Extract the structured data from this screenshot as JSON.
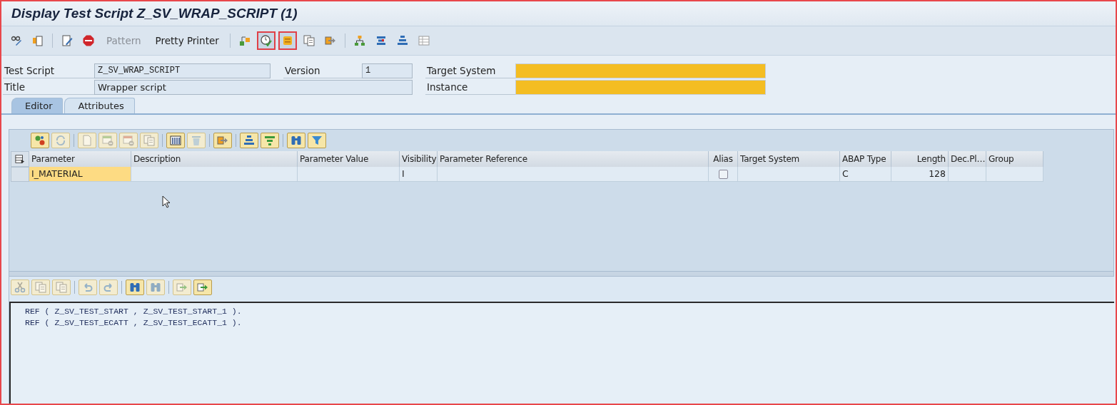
{
  "window": {
    "title": "Display Test Script Z_SV_WRAP_SCRIPT (1)"
  },
  "toolbar": [
    {
      "kind": "icon",
      "highlighted": false
    },
    {
      "kind": "icon",
      "highlighted": false
    },
    {
      "kind": "separator"
    },
    {
      "kind": "icon",
      "highlighted": false
    },
    {
      "kind": "icon",
      "highlighted": false
    },
    {
      "kind": "text",
      "label": "Pattern",
      "disabled": true
    },
    {
      "kind": "text",
      "label": "Pretty Printer",
      "disabled": false
    },
    {
      "kind": "separator"
    },
    {
      "kind": "icon",
      "highlighted": false
    },
    {
      "kind": "icon",
      "highlighted": true
    },
    {
      "kind": "icon",
      "highlighted": true
    },
    {
      "kind": "icon",
      "highlighted": false
    },
    {
      "kind": "icon",
      "highlighted": false
    },
    {
      "kind": "separator"
    },
    {
      "kind": "icon",
      "highlighted": false
    },
    {
      "kind": "icon",
      "highlighted": false
    },
    {
      "kind": "icon",
      "highlighted": false
    },
    {
      "kind": "icon",
      "highlighted": false
    }
  ],
  "header_fields": [
    {
      "label": "Test Script",
      "value": "Z_SV_WRAP_SCRIPT",
      "kind": "mono",
      "redacted": false
    },
    {
      "label": "Version",
      "value": "1",
      "kind": "mono",
      "redacted": false
    },
    {
      "label": "Target System",
      "kind": "text",
      "redacted": true
    },
    {
      "label": "Title",
      "value": "Wrapper script",
      "kind": "text",
      "redacted": false
    },
    {
      "label": "Instance",
      "kind": "text",
      "redacted": true
    }
  ],
  "tabs": [
    {
      "label": "Editor",
      "selected": true
    },
    {
      "label": "Attributes",
      "selected": false
    }
  ],
  "grid_toolbar": [
    {
      "kind": "button",
      "disabled": false
    },
    {
      "kind": "button",
      "disabled": true
    },
    {
      "kind": "separator"
    },
    {
      "kind": "button",
      "disabled": true
    },
    {
      "kind": "button",
      "disabled": true
    },
    {
      "kind": "button",
      "disabled": true
    },
    {
      "kind": "button",
      "disabled": true
    },
    {
      "kind": "separator"
    },
    {
      "kind": "button",
      "disabled": false
    },
    {
      "kind": "button",
      "disabled": true
    },
    {
      "kind": "separator"
    },
    {
      "kind": "button",
      "disabled": false
    },
    {
      "kind": "separator"
    },
    {
      "kind": "button",
      "disabled": false
    },
    {
      "kind": "button",
      "disabled": false
    },
    {
      "kind": "separator"
    },
    {
      "kind": "button",
      "disabled": false
    },
    {
      "kind": "button",
      "disabled": false
    }
  ],
  "table": {
    "columns": [
      {
        "label": "Parameter",
        "kind": "key"
      },
      {
        "label": "Description",
        "kind": "text"
      },
      {
        "label": "Parameter Value",
        "kind": "text"
      },
      {
        "label": "Visibility",
        "kind": "text"
      },
      {
        "label": "Parameter Reference",
        "kind": "text"
      },
      {
        "label": "Alias",
        "kind": "checkbox"
      },
      {
        "label": "Target System",
        "kind": "text"
      },
      {
        "label": "ABAP Type",
        "kind": "text"
      },
      {
        "label": "Length",
        "kind": "number"
      },
      {
        "label": "Dec.Pl…",
        "kind": "number"
      },
      {
        "label": "Group",
        "kind": "text"
      }
    ],
    "rows": [
      {
        "cells": [
          "I_MATERIAL",
          "",
          "",
          "I",
          "",
          false,
          "",
          "C",
          "128",
          "",
          ""
        ]
      }
    ]
  },
  "editor_toolbar": [
    {
      "kind": "button",
      "disabled": true
    },
    {
      "kind": "button",
      "disabled": true
    },
    {
      "kind": "button",
      "disabled": true
    },
    {
      "kind": "separator"
    },
    {
      "kind": "button",
      "disabled": true
    },
    {
      "kind": "button",
      "disabled": true
    },
    {
      "kind": "separator"
    },
    {
      "kind": "button",
      "disabled": false
    },
    {
      "kind": "button",
      "disabled": true
    },
    {
      "kind": "separator"
    },
    {
      "kind": "button",
      "disabled": true
    },
    {
      "kind": "button",
      "disabled": false
    }
  ],
  "code_lines": [
    "REF ( Z_SV_TEST_START , Z_SV_TEST_START_1 ).",
    "REF ( Z_SV_TEST_ECATT , Z_SV_TEST_ECATT_1 )."
  ]
}
